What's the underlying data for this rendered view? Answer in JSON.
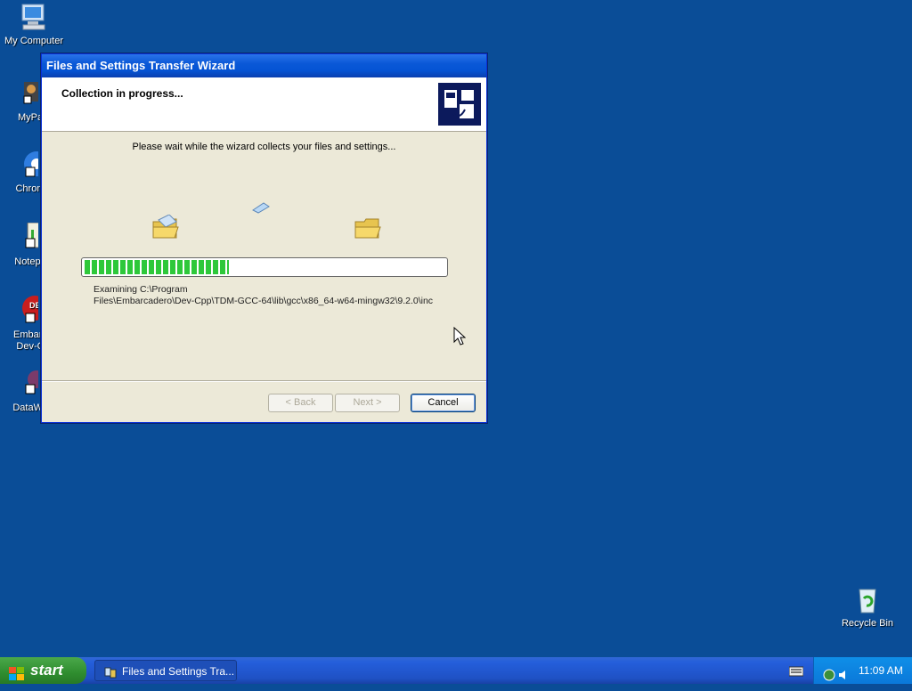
{
  "desktop": {
    "icons": [
      {
        "label": "My Computer"
      },
      {
        "label": "MyPa"
      },
      {
        "label": "Chrom"
      },
      {
        "label": "Notepa"
      },
      {
        "label": "Embarc"
      },
      {
        "label": "Dev-C"
      },
      {
        "label": "DataWa"
      },
      {
        "label": "Recycle Bin"
      }
    ]
  },
  "window": {
    "title": "Files and Settings Transfer Wizard",
    "header_title": "Collection in progress...",
    "wait_message": "Please wait while the wizard collects your files and settings...",
    "progress": 0.4,
    "examining_line1": "Examining C:\\Program",
    "examining_line2": "Files\\Embarcadero\\Dev-Cpp\\TDM-GCC-64\\lib\\gcc\\x86_64-w64-mingw32\\9.2.0\\inc",
    "buttons": {
      "back": "< Back",
      "next": "Next >",
      "cancel": "Cancel"
    }
  },
  "taskbar": {
    "start_label": "start",
    "task_label": "Files and Settings Tra...",
    "clock": "11:09 AM"
  },
  "colors": {
    "desktop": "#0a4d97",
    "progress": "#2ec83a",
    "titlebar": "#0a58d7"
  }
}
